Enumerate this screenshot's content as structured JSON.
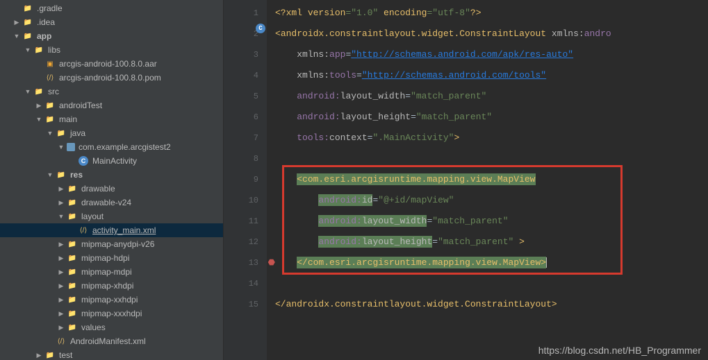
{
  "tree": [
    {
      "d": 1,
      "a": "",
      "i": "folder-gradle",
      "t": ".gradle"
    },
    {
      "d": 1,
      "a": "▶",
      "i": "folder",
      "t": ".idea"
    },
    {
      "d": 1,
      "a": "▼",
      "i": "module",
      "t": "app",
      "b": true
    },
    {
      "d": 2,
      "a": "▼",
      "i": "folder",
      "t": "libs"
    },
    {
      "d": 3,
      "a": "",
      "i": "jar-ic",
      "t": "arcgis-android-100.8.0.aar"
    },
    {
      "d": 3,
      "a": "",
      "i": "xml-ic",
      "t": "arcgis-android-100.8.0.pom"
    },
    {
      "d": 2,
      "a": "▼",
      "i": "folder",
      "t": "src"
    },
    {
      "d": 3,
      "a": "▶",
      "i": "folder",
      "t": "androidTest"
    },
    {
      "d": 3,
      "a": "▼",
      "i": "folder",
      "t": "main"
    },
    {
      "d": 4,
      "a": "▼",
      "i": "folder",
      "t": "java"
    },
    {
      "d": 5,
      "a": "▼",
      "i": "pkg",
      "t": "com.example.arcgistest2"
    },
    {
      "d": 6,
      "a": "",
      "i": "c-ic",
      "t": "MainActivity"
    },
    {
      "d": 4,
      "a": "▼",
      "i": "folder",
      "t": "res",
      "b": true
    },
    {
      "d": 5,
      "a": "▶",
      "i": "folder",
      "t": "drawable"
    },
    {
      "d": 5,
      "a": "▶",
      "i": "folder",
      "t": "drawable-v24"
    },
    {
      "d": 5,
      "a": "▼",
      "i": "folder",
      "t": "layout"
    },
    {
      "d": 6,
      "a": "",
      "i": "xml-ic",
      "t": "activity_main.xml",
      "sel": true,
      "u": true
    },
    {
      "d": 5,
      "a": "▶",
      "i": "folder",
      "t": "mipmap-anydpi-v26"
    },
    {
      "d": 5,
      "a": "▶",
      "i": "folder",
      "t": "mipmap-hdpi"
    },
    {
      "d": 5,
      "a": "▶",
      "i": "folder",
      "t": "mipmap-mdpi"
    },
    {
      "d": 5,
      "a": "▶",
      "i": "folder",
      "t": "mipmap-xhdpi"
    },
    {
      "d": 5,
      "a": "▶",
      "i": "folder",
      "t": "mipmap-xxhdpi"
    },
    {
      "d": 5,
      "a": "▶",
      "i": "folder",
      "t": "mipmap-xxxhdpi"
    },
    {
      "d": 5,
      "a": "▶",
      "i": "folder",
      "t": "values"
    },
    {
      "d": 4,
      "a": "",
      "i": "xml-ic",
      "t": "AndroidManifest.xml"
    },
    {
      "d": 3,
      "a": "▶",
      "i": "folder",
      "t": "test"
    }
  ],
  "lines": [
    "1",
    "2",
    "3",
    "4",
    "5",
    "6",
    "7",
    "8",
    "9",
    "10",
    "11",
    "12",
    "13",
    "14",
    "15"
  ],
  "code": {
    "l1": {
      "a": "<?",
      "b": "xml version",
      "c": "=\"1.0\"",
      "d": " encoding",
      "e": "=\"utf-8\"",
      "f": "?>"
    },
    "l2": {
      "a": "<",
      "b": "androidx.constraintlayout.widget.ConstraintLayout ",
      "c": "xmlns:",
      "d": "andro"
    },
    "l3": {
      "a": "xmlns:",
      "b": "app",
      "c": "=",
      "d": "\"http://schemas.android.com/apk/res-auto\""
    },
    "l4": {
      "a": "xmlns:",
      "b": "tools",
      "c": "=",
      "d": "\"http://schemas.android.com/tools\""
    },
    "l5": {
      "a": "android:",
      "b": "layout_width",
      "c": "=",
      "d": "\"match_parent\""
    },
    "l6": {
      "a": "android:",
      "b": "layout_height",
      "c": "=",
      "d": "\"match_parent\""
    },
    "l7": {
      "a": "tools:",
      "b": "context",
      "c": "=",
      "d": "\".MainActivity\"",
      "e": ">"
    },
    "l9": {
      "a": "<",
      "b": "com.esri.arcgisruntime.mapping.view.MapView"
    },
    "l10": {
      "a": "android:",
      "b": "id",
      "c": "=",
      "d": "\"@+id/mapView\""
    },
    "l11": {
      "a": "android:",
      "b": "layout_width",
      "c": "=",
      "d": "\"match_parent\""
    },
    "l12": {
      "a": "android:",
      "b": "layout_height",
      "c": "=",
      "d": "\"match_parent\"",
      "e": " >"
    },
    "l13": {
      "a": "</",
      "b": "com.esri.arcgisruntime.mapping.view.MapView",
      "c": ">"
    },
    "l15": {
      "a": "</",
      "b": "androidx.constraintlayout.widget.ConstraintLayout",
      "c": ">"
    }
  },
  "watermark": "https://blog.csdn.net/HB_Programmer"
}
